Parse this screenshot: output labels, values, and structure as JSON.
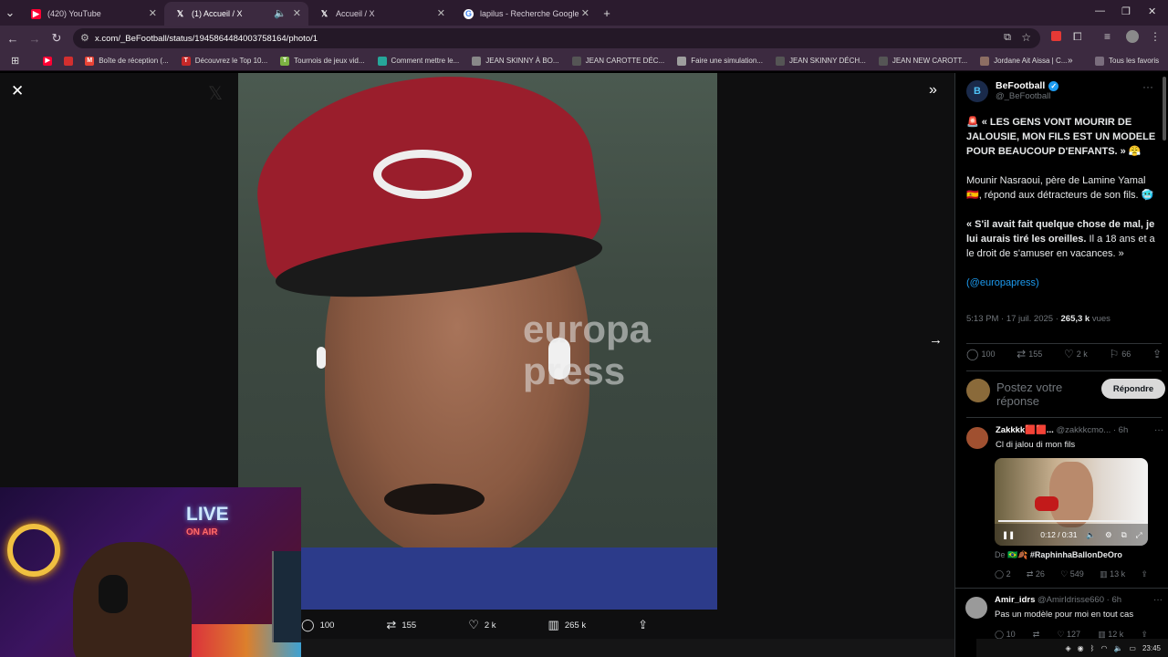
{
  "browser": {
    "tabs": [
      {
        "title": "(420) YouTube",
        "icon": "youtube-icon",
        "color": "#ff0033"
      },
      {
        "title": "(1) Accueil / X",
        "icon": "x-logo-icon",
        "active": true
      },
      {
        "title": "Accueil / X",
        "icon": "x-logo-icon"
      },
      {
        "title": "lapilus - Recherche Google",
        "icon": "google-icon"
      }
    ],
    "url": "x.com/_BeFootball/status/1945864484003758164/photo/1",
    "bookmarks": [
      {
        "label": "Boîte de réception (...",
        "icon": "gmail-icon",
        "color": "#ea4335"
      },
      {
        "label": "Découvrez le Top 10...",
        "icon": "tl-icon",
        "color": "#c62828"
      },
      {
        "label": "Tournois de jeux vid...",
        "icon": "tournament-icon",
        "color": "#7cb342"
      },
      {
        "label": "Comment mettre le...",
        "icon": "bookmark-site-icon",
        "color": "#26a69a"
      },
      {
        "label": "JEAN SKINNY À BO...",
        "icon": "jean-icon",
        "color": "#888888"
      },
      {
        "label": "JEAN CAROTTE DÉC...",
        "icon": "brand-icon",
        "color": "#555555"
      },
      {
        "label": "Faire une simulation...",
        "icon": "document-icon",
        "color": "#9e9e9e"
      },
      {
        "label": "JEAN SKINNY DÉCH...",
        "icon": "brand-icon",
        "color": "#555555"
      },
      {
        "label": "JEAN NEW CAROTT...",
        "icon": "brand-icon",
        "color": "#555555"
      },
      {
        "label": "Jordane Ait Aissa | C...",
        "icon": "profile-icon",
        "color": "#8d6e63"
      }
    ],
    "all_favorites": "Tous les favoris"
  },
  "photo": {
    "watermark": "europa press",
    "actions": {
      "replies": "100",
      "reposts": "155",
      "likes": "2 k",
      "views": "265 k"
    }
  },
  "webcam": {
    "live_line1": "LIVE",
    "live_line2": "ON AIR"
  },
  "tweet": {
    "author": "BeFootball",
    "handle": "@_BeFootball",
    "line1": "🚨 « LES GENS VONT MOURIR DE JALOUSIE, MON FILS EST UN MODELE POUR BEAUCOUP D'ENFANTS. » 😤",
    "line2": "Mounir Nasraoui, père de Lamine Yamal 🇪🇸, répond aux détracteurs de son fils. 🥶",
    "line3_bold": "« S'il avait fait quelque chose de mal, je lui aurais tiré les oreilles.",
    "line3_rest": " Il a 18 ans et a le droit de s'amuser en vacances. »",
    "credit": "(@europapress)",
    "time": "5:13 PM · 17 juil. 2025 · ",
    "views": "265,3 k",
    "views_label": " vues",
    "stats": {
      "replies": "100",
      "reposts": "155",
      "likes": "2 k",
      "bookmarks": "66"
    },
    "reply_placeholder": "Postez votre réponse",
    "reply_button": "Répondre"
  },
  "replies": [
    {
      "name": "Zakkkk🟥🟥...",
      "handle": "@zakkkcmo... · 6h",
      "text": "Cl di jalou di mon fils",
      "video_time": "0:12 / 0:31",
      "hashtag_prefix": "De 🇧🇷🍂 ",
      "hashtag": "#RaphinhaBallonDeOro",
      "stats": {
        "replies": "2",
        "reposts": "26",
        "likes": "549",
        "views": "13 k"
      }
    },
    {
      "name": "Amir_idrs",
      "handle": "@AmirIdrisse660 · 6h",
      "text": "Pas un modèle pour moi en tout cas",
      "stats": {
        "replies": "10",
        "reposts": "",
        "likes": "127",
        "views": "12 k"
      }
    }
  ],
  "taskbar": {
    "time": "23:45"
  }
}
